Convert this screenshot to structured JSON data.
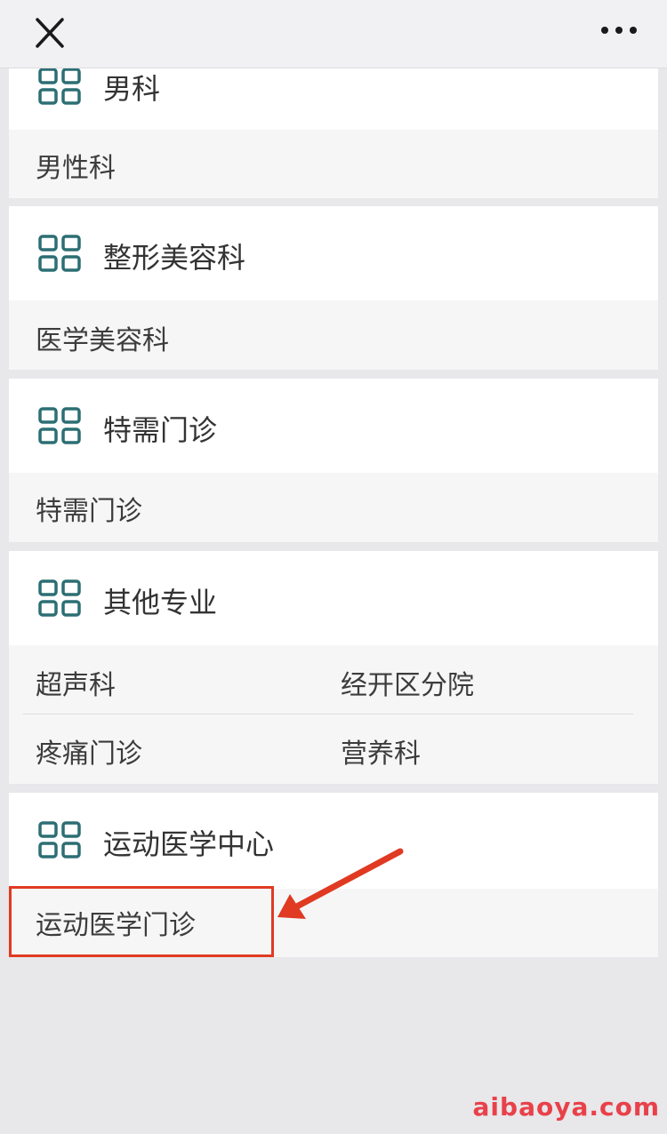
{
  "topbar": {
    "close_icon": "close-icon",
    "more_icon": "more-icon"
  },
  "sections": [
    {
      "title": "男科",
      "items": [
        "男性科"
      ]
    },
    {
      "title": "整形美容科",
      "items": [
        "医学美容科"
      ]
    },
    {
      "title": "特需门诊",
      "items": [
        "特需门诊"
      ]
    },
    {
      "title": "其他专业",
      "items": [
        "超声科",
        "经开区分院",
        "疼痛门诊",
        "营养科"
      ]
    },
    {
      "title": "运动医学中心",
      "items": [
        "运动医学门诊"
      ]
    }
  ],
  "icon": "grid-icon",
  "colors": {
    "icon": "#2c6e73",
    "highlight": "#e03a22",
    "watermark": "#e8414a"
  },
  "watermark": "aibaoya.com"
}
